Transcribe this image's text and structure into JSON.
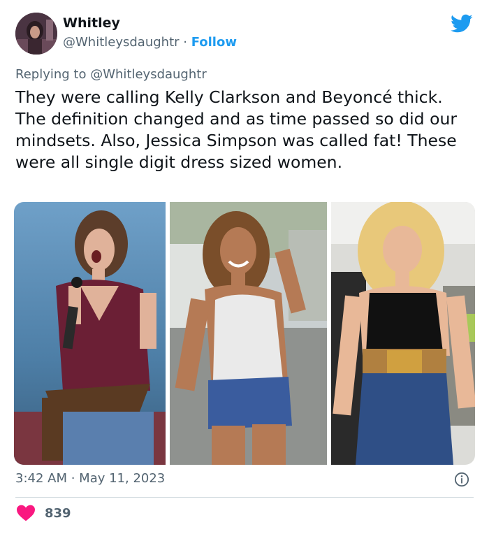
{
  "author": {
    "name": "Whitley",
    "handle": "@Whitleysdaughtr",
    "separator": " · ",
    "follow_label": "Follow",
    "avatar_icon": "profile-photo"
  },
  "reply_line": "Replying to @Whitleysdaughtr",
  "tweet_text": "They were calling Kelly Clarkson and Beyoncé thick. The definition changed and as time passed so did our mindsets. Also, Jessica Simpson was called fat! These were all single digit dress sized women.",
  "media": [
    {
      "icon": "photo-kelly-clarkson"
    },
    {
      "icon": "photo-beyonce"
    },
    {
      "icon": "photo-jessica-simpson"
    }
  ],
  "timestamp": {
    "time": "3:42 AM",
    "separator": " · ",
    "date": "May 11, 2023"
  },
  "likes": {
    "count": "839",
    "icon": "heart-icon"
  },
  "colors": {
    "accent": "#1d9bf0",
    "secondary_text": "#536471",
    "heart": "#f91880",
    "divider": "#cfd9de"
  }
}
